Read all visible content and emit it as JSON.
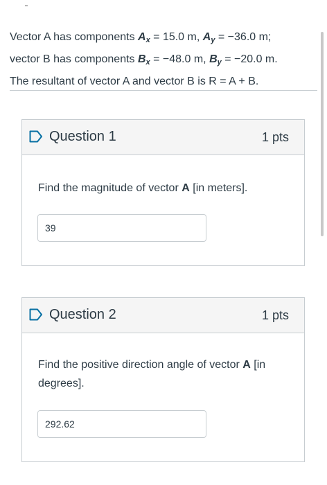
{
  "intro": {
    "line1_prefix": "Vector A has components ",
    "ax_label": "A",
    "ax_sub": "x",
    "ax_value": " = 15.0 m, ",
    "ay_label": "A",
    "ay_sub": "y",
    "ay_value": " = −36.0 m;",
    "line2_prefix": "vector B has components ",
    "bx_label": "B",
    "bx_sub": "x",
    "bx_value": " = −48.0 m, ",
    "by_label": "B",
    "by_sub": "y",
    "by_value": " = −20.0 m.",
    "line3": "The resultant of vector A and vector B is R = A + B."
  },
  "questions": [
    {
      "title": "Question 1",
      "points": "1 pts",
      "text_prefix": "Find the magnitude of vector ",
      "text_bold": "A",
      "text_suffix": " [in meters].",
      "answer": "39"
    },
    {
      "title": "Question 2",
      "points": "1 pts",
      "text_prefix": "Find the positive direction angle of vector ",
      "text_bold": "A",
      "text_suffix": " [in degrees].",
      "answer": "292.62"
    }
  ],
  "icons": {
    "flag": "flag-outline-icon"
  },
  "colors": {
    "text": "#2d3b45",
    "border": "#c7cdd1",
    "header_bg": "#f5f5f5",
    "flag": "#0770a3"
  }
}
